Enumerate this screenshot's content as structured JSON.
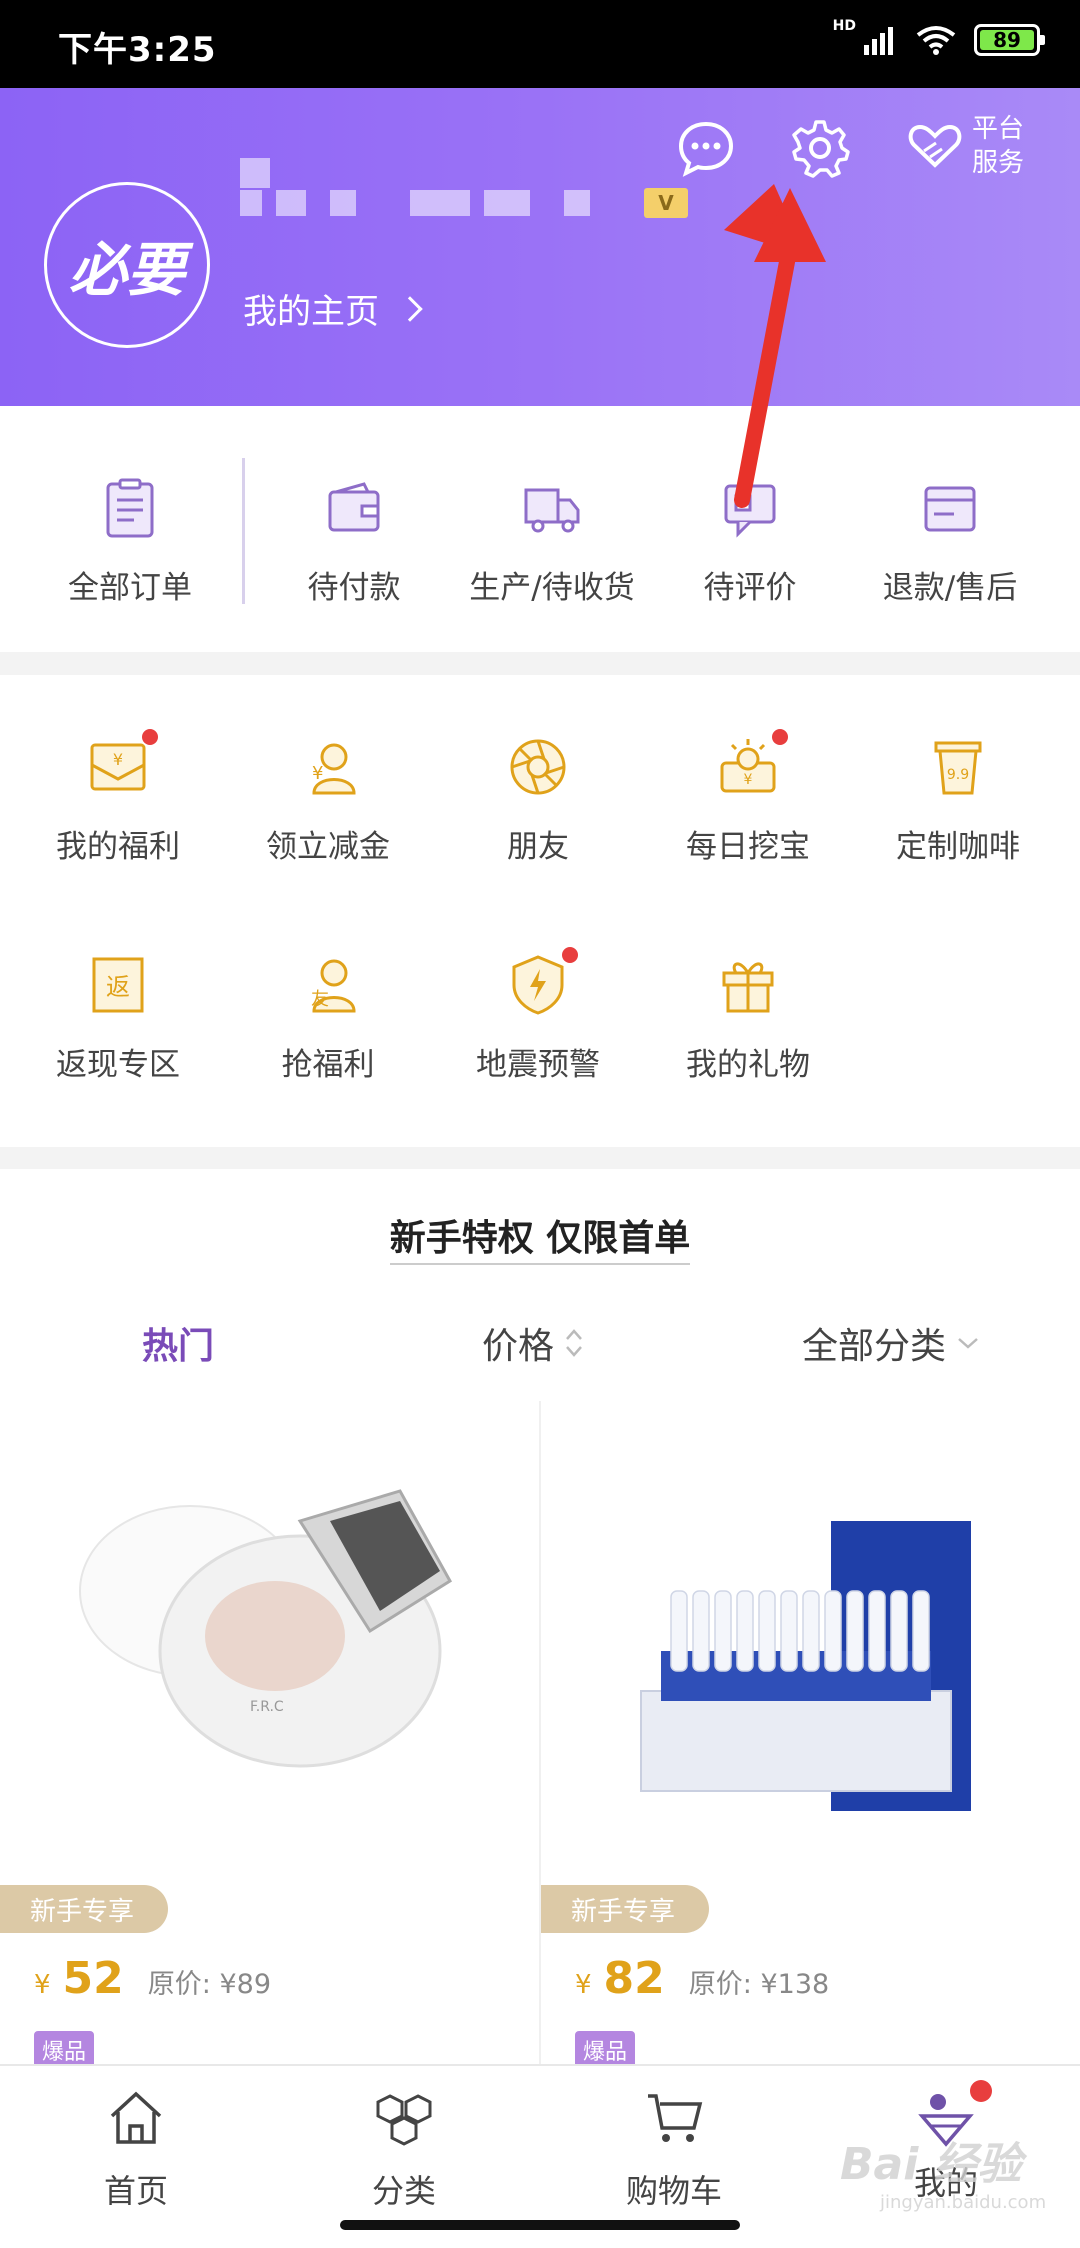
{
  "status_bar": {
    "time": "下午3:25",
    "network": "HD",
    "battery": "89"
  },
  "header": {
    "avatar_text": "必要",
    "vip_badge": "V",
    "home_link": "我的主页",
    "platform_service": "平台服务",
    "platform_line1": "平台",
    "platform_line2": "服务"
  },
  "orders": {
    "items": [
      {
        "label": "全部订单",
        "icon": "order-list-icon"
      },
      {
        "label": "待付款",
        "icon": "wallet-icon"
      },
      {
        "label": "生产/待收货",
        "icon": "truck-icon"
      },
      {
        "label": "待评价",
        "icon": "review-icon"
      },
      {
        "label": "退款/售后",
        "icon": "refund-icon"
      }
    ]
  },
  "services": {
    "items": [
      {
        "label": "我的福利",
        "icon": "welfare-envelope-icon",
        "dot": true
      },
      {
        "label": "领立减金",
        "icon": "discount-coin-icon",
        "dot": false
      },
      {
        "label": "朋友",
        "icon": "aperture-icon",
        "dot": false
      },
      {
        "label": "每日挖宝",
        "icon": "treasure-icon",
        "dot": true
      },
      {
        "label": "定制咖啡",
        "icon": "coffee-cup-icon",
        "dot": false
      },
      {
        "label": "返现专区",
        "icon": "cashback-icon",
        "dot": false
      },
      {
        "label": "抢福利",
        "icon": "friends-icon",
        "dot": false
      },
      {
        "label": "地震预警",
        "icon": "shield-bolt-icon",
        "dot": true
      },
      {
        "label": "我的礼物",
        "icon": "gift-icon",
        "dot": false
      }
    ]
  },
  "products_section": {
    "title": "新手特权 仅限首单",
    "filters": {
      "hot": "热门",
      "price": "价格",
      "category": "全部分类"
    },
    "cards": [
      {
        "tag": "新手专享",
        "currency": "¥",
        "price": "52",
        "original": "原价: ¥89",
        "badge": "爆品"
      },
      {
        "tag": "新手专享",
        "currency": "¥",
        "price": "82",
        "original": "原价: ¥138",
        "badge": "爆品"
      }
    ]
  },
  "tabbar": {
    "items": [
      {
        "label": "首页",
        "icon": "home-icon"
      },
      {
        "label": "分类",
        "icon": "category-hex-icon"
      },
      {
        "label": "购物车",
        "icon": "cart-icon"
      },
      {
        "label": "我的",
        "icon": "profile-icon"
      }
    ]
  },
  "watermark": {
    "text": "Bai 经验",
    "sub": "jingyan.baidu.com"
  },
  "colors": {
    "header_start": "#8c63f5",
    "header_end": "#a98af7",
    "accent_gold": "#e0a21a",
    "active_purple": "#7a4bb8",
    "annotation_red": "#e8322a"
  }
}
